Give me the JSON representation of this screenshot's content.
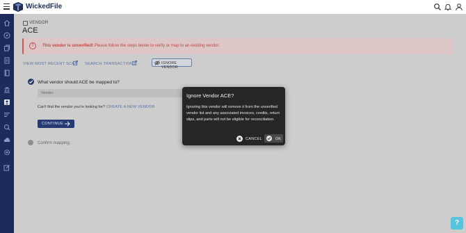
{
  "app": {
    "name": "WickedFile"
  },
  "breadcrumb": {
    "label": "VENDOR"
  },
  "vendor": {
    "name": "ACE"
  },
  "alert": {
    "bold": "This vendor is unverified!",
    "text": " Please follow the steps below to verify or map to an existing vendor."
  },
  "actions": {
    "view_scan": "VIEW MOST RECENT SCAN",
    "search_transactions": "SEARCH TRANSACTIONS",
    "ignore_vendor": "IGNORE VENDOR"
  },
  "step1": {
    "question": "What vendor should ACE be mapped to?",
    "vendor_placeholder": "Vendor",
    "cant_find": "Can't find the vendor you're looking for?",
    "create_link": "CREATE A NEW VENDOR",
    "continue_label": "CONTINUE"
  },
  "step2": {
    "label": "Confirm mapping."
  },
  "modal": {
    "title": "Ignore Vendor ACE?",
    "body": "Ignoring this vendor will remove it from the unverified vendor list and any associated invoices, credits, return slips, and parts will not be eligible for reconciliation.",
    "cancel_label": "CANCEL",
    "ok_label": "OK"
  },
  "help": {
    "label": "?"
  },
  "colors": {
    "sidebar": "#1d2a5c",
    "primary": "#253a72",
    "alert": "#c04848",
    "link": "#5570a8",
    "help": "#55c4dc"
  }
}
